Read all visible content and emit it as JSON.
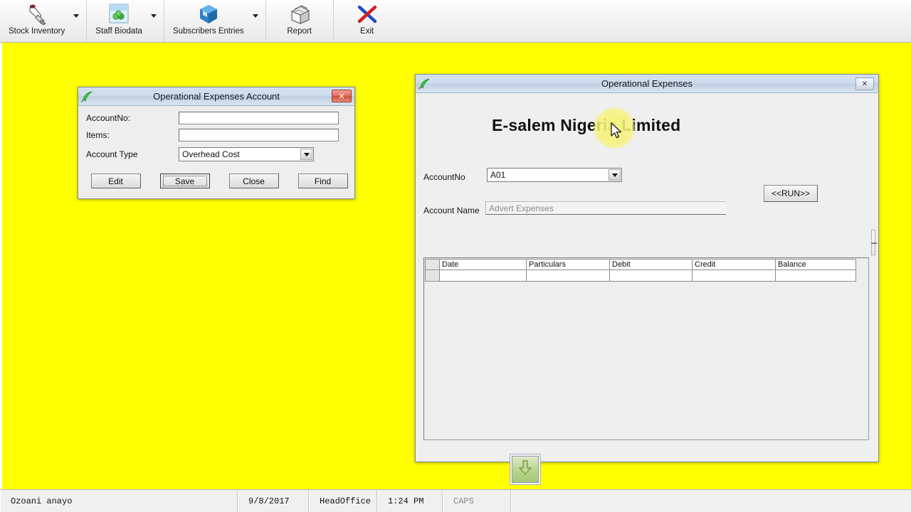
{
  "toolbar": {
    "items": [
      {
        "label": "Stock Inventory",
        "icon": "hand-pointer-icon",
        "has_dropdown": true
      },
      {
        "label": "Staff Biodata",
        "icon": "puzzle-piece-icon",
        "has_dropdown": true
      },
      {
        "label": "Subscribers Entries",
        "icon": "blue-cube-icon",
        "has_dropdown": true
      },
      {
        "label": "Report",
        "icon": "file-box-icon",
        "has_dropdown": false
      },
      {
        "label": "Exit",
        "icon": "red-blue-x-icon",
        "has_dropdown": false
      }
    ]
  },
  "desktop": {
    "background_color": "#ffff00"
  },
  "account_dialog": {
    "title": "Operational Expenses Account",
    "close_label": "✕",
    "fields": {
      "account_no_label": "AccountNo:",
      "account_no_value": "",
      "items_label": "Items:",
      "items_value": "",
      "account_type_label": "Account Type",
      "account_type_value": "Overhead Cost"
    },
    "buttons": {
      "edit": "Edit",
      "save": "Save",
      "close": "Close",
      "find": "Find"
    }
  },
  "expenses_window": {
    "title": "Operational Expenses",
    "close_label": "✕",
    "company_name": "E-salem Nigeria Limited",
    "account_no_label": "AccountNo",
    "account_no_value": "A01",
    "account_name_label": "Account Name",
    "account_name_value": "Advert Expenses",
    "run_button": "<<RUN>>",
    "grid": {
      "columns": [
        "Date",
        "Particulars",
        "Debit",
        "Credit",
        "Balance"
      ],
      "rows": [
        [
          "",
          "",
          "",
          "",
          ""
        ]
      ]
    }
  },
  "scroll_down_button": {
    "icon": "green-down-arrow-icon"
  },
  "status_bar": {
    "user": "Ozoani  anayo",
    "date": "9/8/2017",
    "office": "HeadOffice",
    "time": "1:24 PM",
    "caps": "CAPS"
  }
}
